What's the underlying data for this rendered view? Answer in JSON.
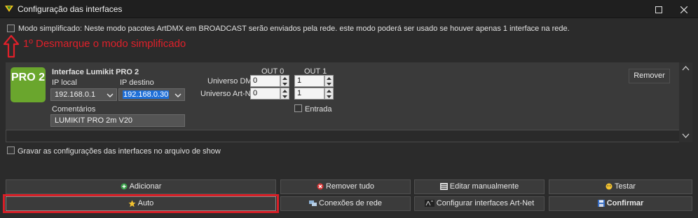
{
  "window": {
    "title": "Configuração das interfaces",
    "maximize_icon": "maximize-icon",
    "close_icon": "close-icon"
  },
  "simplified_mode": {
    "checked": false,
    "label": "Modo simplificado: Neste modo pacotes ArtDMX em BROADCAST serão enviados pela rede. este modo poderá ser usado se houver apenas 1 interface na rede."
  },
  "annotation": {
    "text": "1º Desmarque o modo simplificado",
    "arrow_icon": "up-arrow-icon",
    "color": "#e0202a"
  },
  "interface": {
    "logo_text": "PRO 2",
    "name": "Interface Lumikit PRO 2",
    "ip_local_label": "IP local",
    "ip_local_value": "192.168.0.1",
    "ip_dest_label": "IP destino",
    "ip_dest_value": "192.168.0.30",
    "comments_label": "Comentários",
    "comments_value": "LUMIKIT PRO 2m V20",
    "out0_label": "OUT 0",
    "out1_label": "OUT 1",
    "universe_dmx_label": "Universo DMX",
    "universe_artnet_label": "Universo Art-Net",
    "dmx_out0": "0",
    "dmx_out1": "1",
    "artnet_out0": "0",
    "artnet_out1": "1",
    "input_label": "Entrada",
    "input_checked": false,
    "remove_label": "Remover"
  },
  "save_show": {
    "checked": false,
    "label": "Gravar as configurações das interfaces no arquivo de show"
  },
  "buttons": {
    "add": "Adicionar",
    "remove_all": "Remover tudo",
    "edit_manual": "Editar manualmente",
    "test": "Testar",
    "auto": "Auto",
    "network_connections": "Conexões de rede",
    "config_artnet": "Configurar interfaces Art-Net",
    "confirm": "Confirmar"
  },
  "colors": {
    "background": "#2b2b2b",
    "titlebar": "#1f1f1f",
    "logo_green": "#6aa62d",
    "highlight_red": "#d81f27",
    "selection_blue": "#1e6fd8"
  }
}
